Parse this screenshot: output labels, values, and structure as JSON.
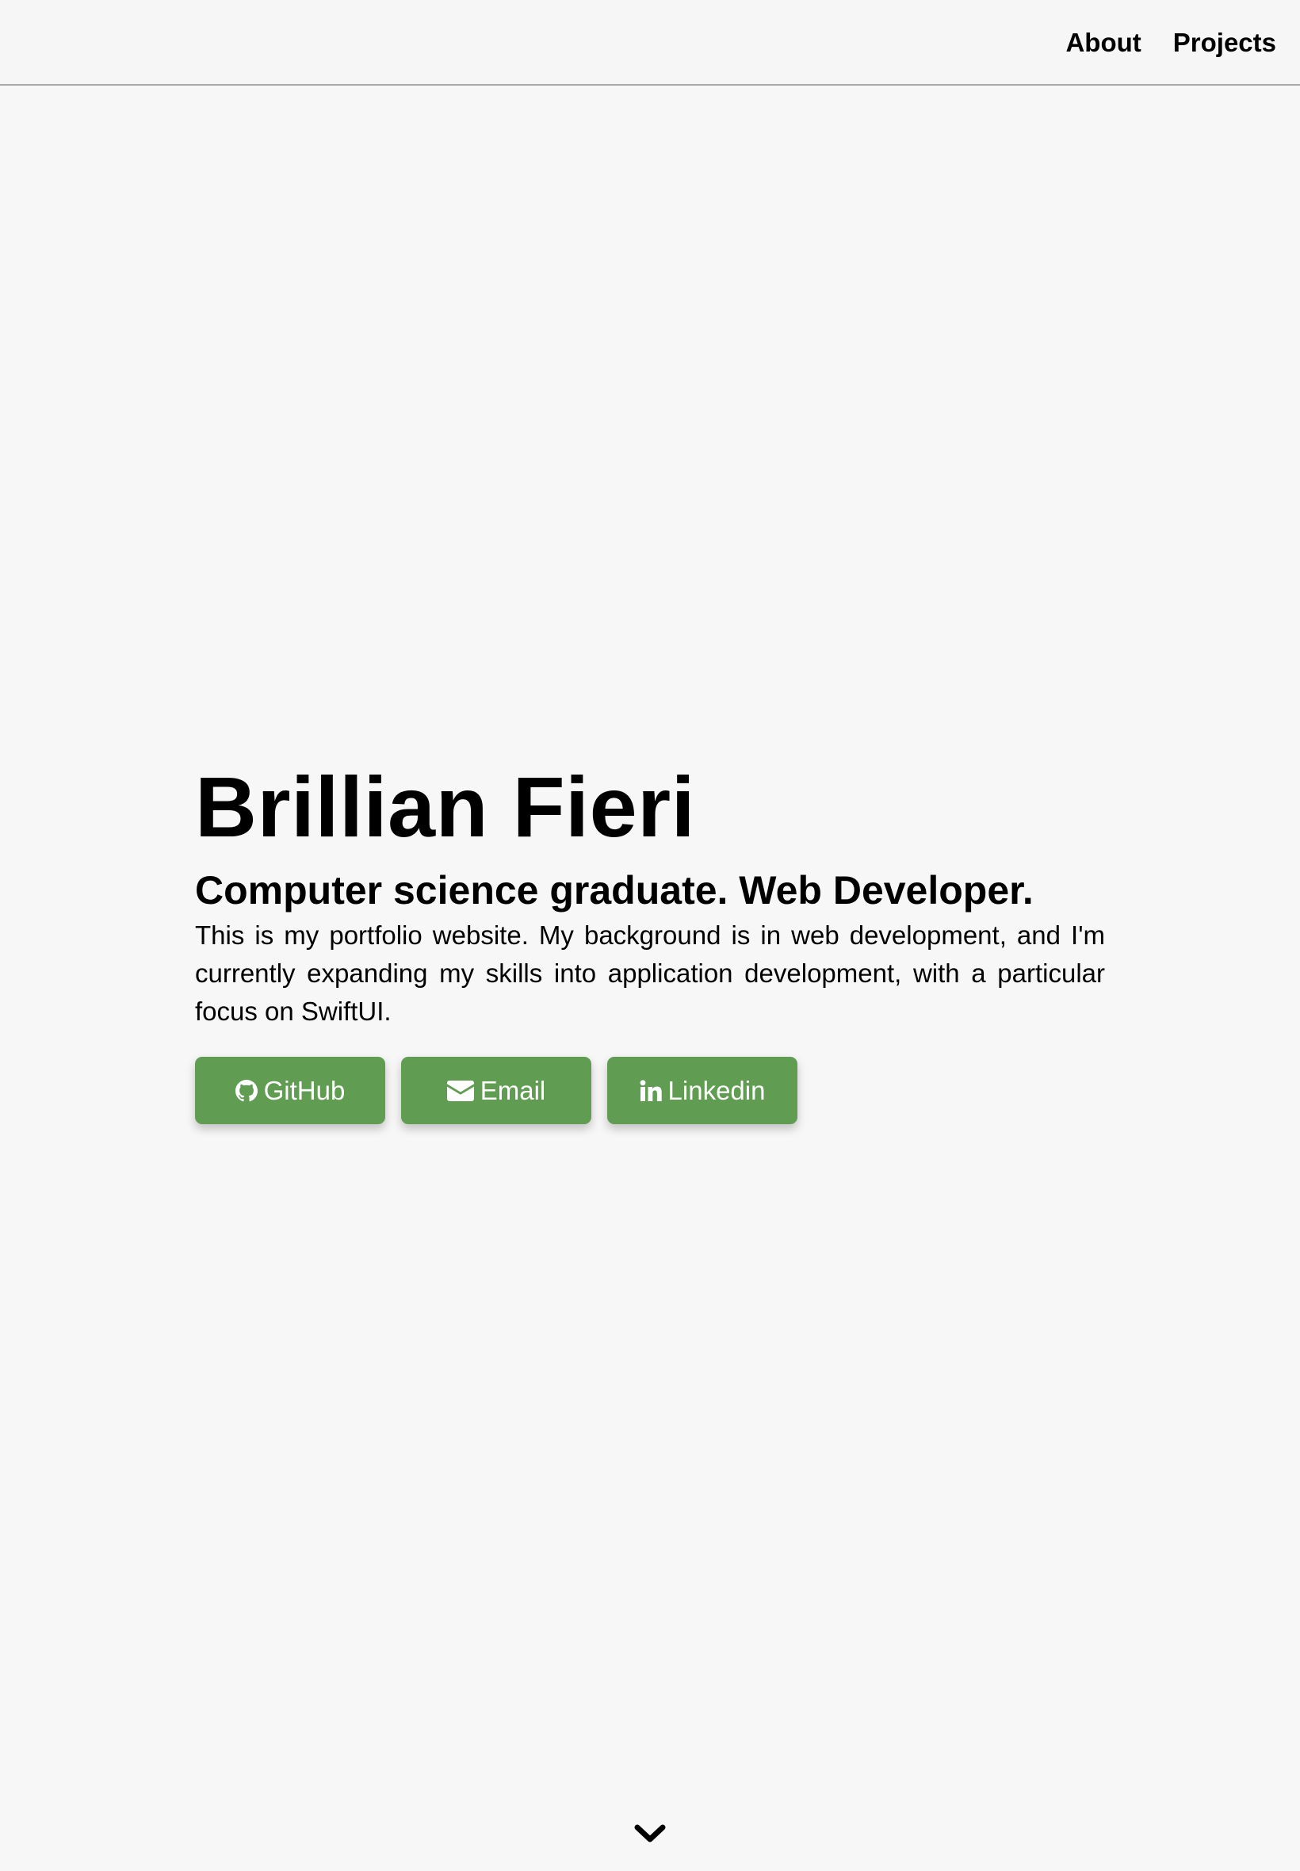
{
  "nav": {
    "links": [
      {
        "label": "About"
      },
      {
        "label": "Projects"
      }
    ]
  },
  "hero": {
    "name": "Brillian Fieri",
    "subtitle": "Computer science graduate. Web Developer.",
    "description": "This is my portfolio website. My background is in web development, and I'm currently expanding my skills into application development, with a particular focus on SwiftUI.",
    "buttons": [
      {
        "label": "GitHub",
        "icon": "github-icon"
      },
      {
        "label": "Email",
        "icon": "envelope-icon"
      },
      {
        "label": "Linkedin",
        "icon": "linkedin-icon"
      }
    ]
  },
  "scroll": {
    "icon": "chevron-down-icon"
  },
  "colors": {
    "background": "#f8f7f7",
    "navbar": "#f6f6f6",
    "button": "#609c51",
    "button_text": "#ffffff",
    "text": "#000000"
  }
}
